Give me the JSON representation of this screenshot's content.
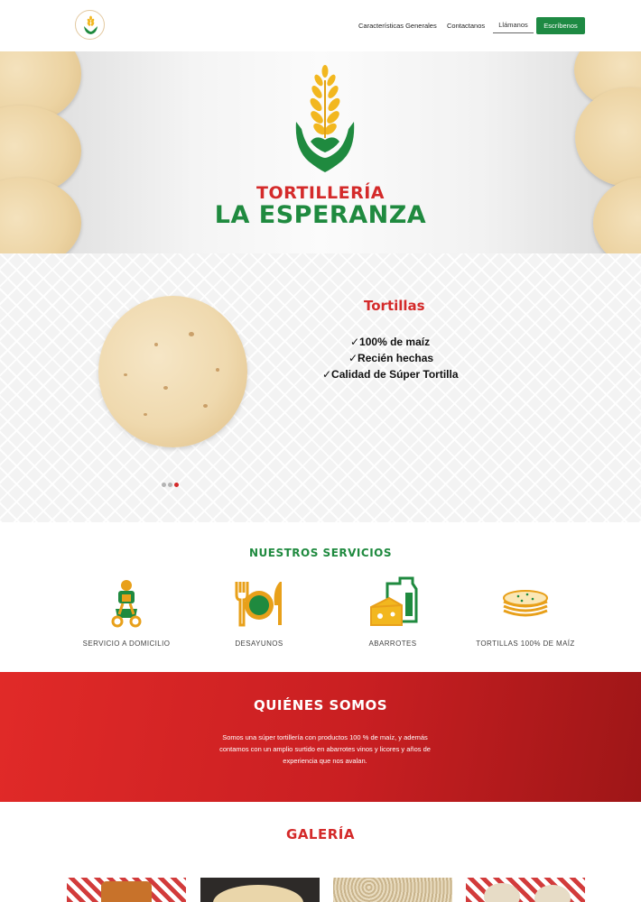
{
  "nav": {
    "links": [
      "Características Generales",
      "Contactanos"
    ],
    "llamanos_label": "Llámanos",
    "escribenos_label": "Escríbenos",
    "logo_icon": "wheat-hands-logo-icon"
  },
  "hero": {
    "title_line1": "TORTILLERÍA",
    "title_line2": "LA ESPERANZA",
    "logo_icon": "wheat-hands-logo-icon"
  },
  "carousel": {
    "slide_title": "Tortillas",
    "items": [
      "✓100% de maíz",
      "✓Recién hechas",
      "✓Calidad de Súper Tortilla"
    ],
    "dots": 3,
    "active_dot": 3
  },
  "services": {
    "title": "NUESTROS SERVICIOS",
    "items": [
      {
        "label": "SERVICIO A DOMICILIO",
        "icon": "delivery-scooter-icon"
      },
      {
        "label": "DESAYUNOS",
        "icon": "plate-cutlery-icon"
      },
      {
        "label": "ABARROTES",
        "icon": "groceries-milk-cheese-icon"
      },
      {
        "label": "TORTILLAS 100% DE MAÍZ",
        "icon": "tortilla-stack-icon"
      }
    ]
  },
  "quienes": {
    "title": "QUIÉNES SOMOS",
    "text": "Somos una súper tortillería con productos 100 % de maíz, y además contamos con un amplio surtido en abarrotes vinos y licores y años de experiencia que nos avalan."
  },
  "galeria": {
    "title": "GALERÍA"
  },
  "colors": {
    "brand_green": "#1e8a43",
    "brand_red": "#d42a2a",
    "brand_yellow": "#f2b71f"
  }
}
